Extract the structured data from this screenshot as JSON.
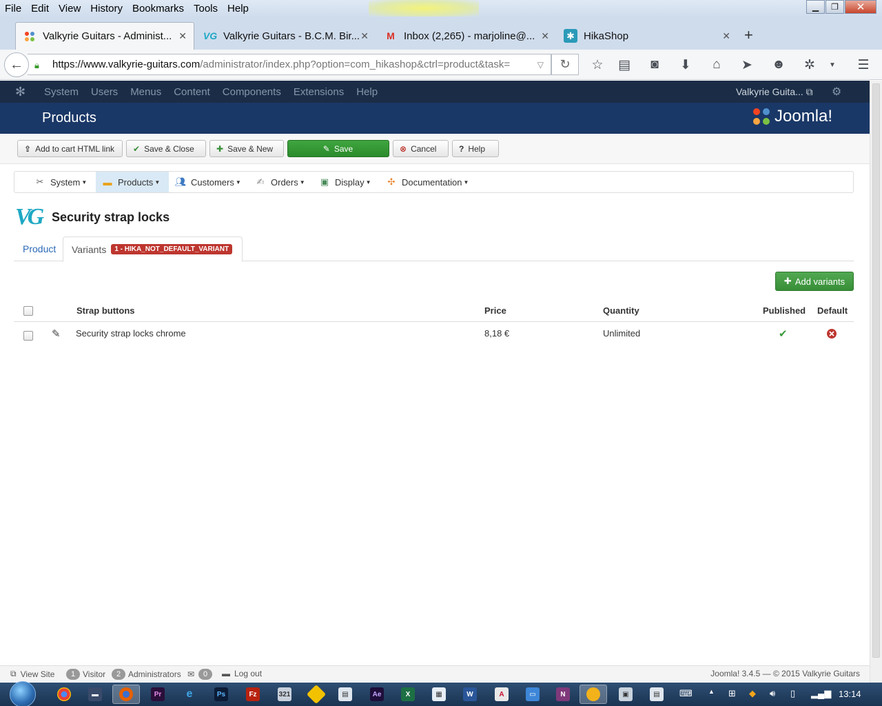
{
  "browser": {
    "menu": [
      "File",
      "Edit",
      "View",
      "History",
      "Bookmarks",
      "Tools",
      "Help"
    ],
    "tabs": [
      {
        "label": "Valkyrie Guitars - Administ...",
        "active": true
      },
      {
        "label": "Valkyrie Guitars - B.C.M. Bir..."
      },
      {
        "label": "Inbox (2,265) - marjoline@..."
      },
      {
        "label": "HikaShop"
      }
    ],
    "url_host": "https://www.valkyrie-guitars.com",
    "url_rest": "/administrator/index.php?option=com_hikashop&ctrl=product&task="
  },
  "joomla_bar": {
    "menus": [
      "System",
      "Users",
      "Menus",
      "Content",
      "Components",
      "Extensions",
      "Help"
    ],
    "site_name": "Valkyrie Guita..."
  },
  "header": {
    "title": "Products",
    "brand": "Joomla!"
  },
  "toolbar": {
    "add_to_cart": "Add to cart HTML link",
    "save_close": "Save & Close",
    "save_new": "Save & New",
    "save": "Save",
    "cancel": "Cancel",
    "help": "Help"
  },
  "hika_menu": [
    "System",
    "Products",
    "Customers",
    "Orders",
    "Display",
    "Documentation"
  ],
  "product": {
    "logo": "VG",
    "name": "Security strap locks"
  },
  "tabs": {
    "product": "Product",
    "variants": "Variants",
    "variants_badge": "1 - HIKA_NOT_DEFAULT_VARIANT"
  },
  "add_variants_label": "Add variants",
  "table": {
    "headers": {
      "name": "Strap buttons",
      "price": "Price",
      "quantity": "Quantity",
      "published": "Published",
      "default": "Default"
    },
    "rows": [
      {
        "name": "Security strap locks chrome",
        "price": "8,18 €",
        "quantity": "Unlimited",
        "published": true,
        "default": false
      }
    ]
  },
  "footer": {
    "view_site": "View Site",
    "visitors_count": "1",
    "visitors": "Visitor",
    "admins_count": "2",
    "admins": "Administrators",
    "messages_count": "0",
    "logout": "Log out",
    "version": "Joomla! 3.4.5",
    "copyright": "© 2015 Valkyrie Guitars"
  },
  "taskbar": {
    "clock": "13:14"
  },
  "colors": {
    "joomla_bar": "#1b2d46",
    "joomla_header": "#1a3867",
    "save_green": "#2f9a2f",
    "badge_red": "#bd362f",
    "link_blue": "#2a69b8"
  }
}
